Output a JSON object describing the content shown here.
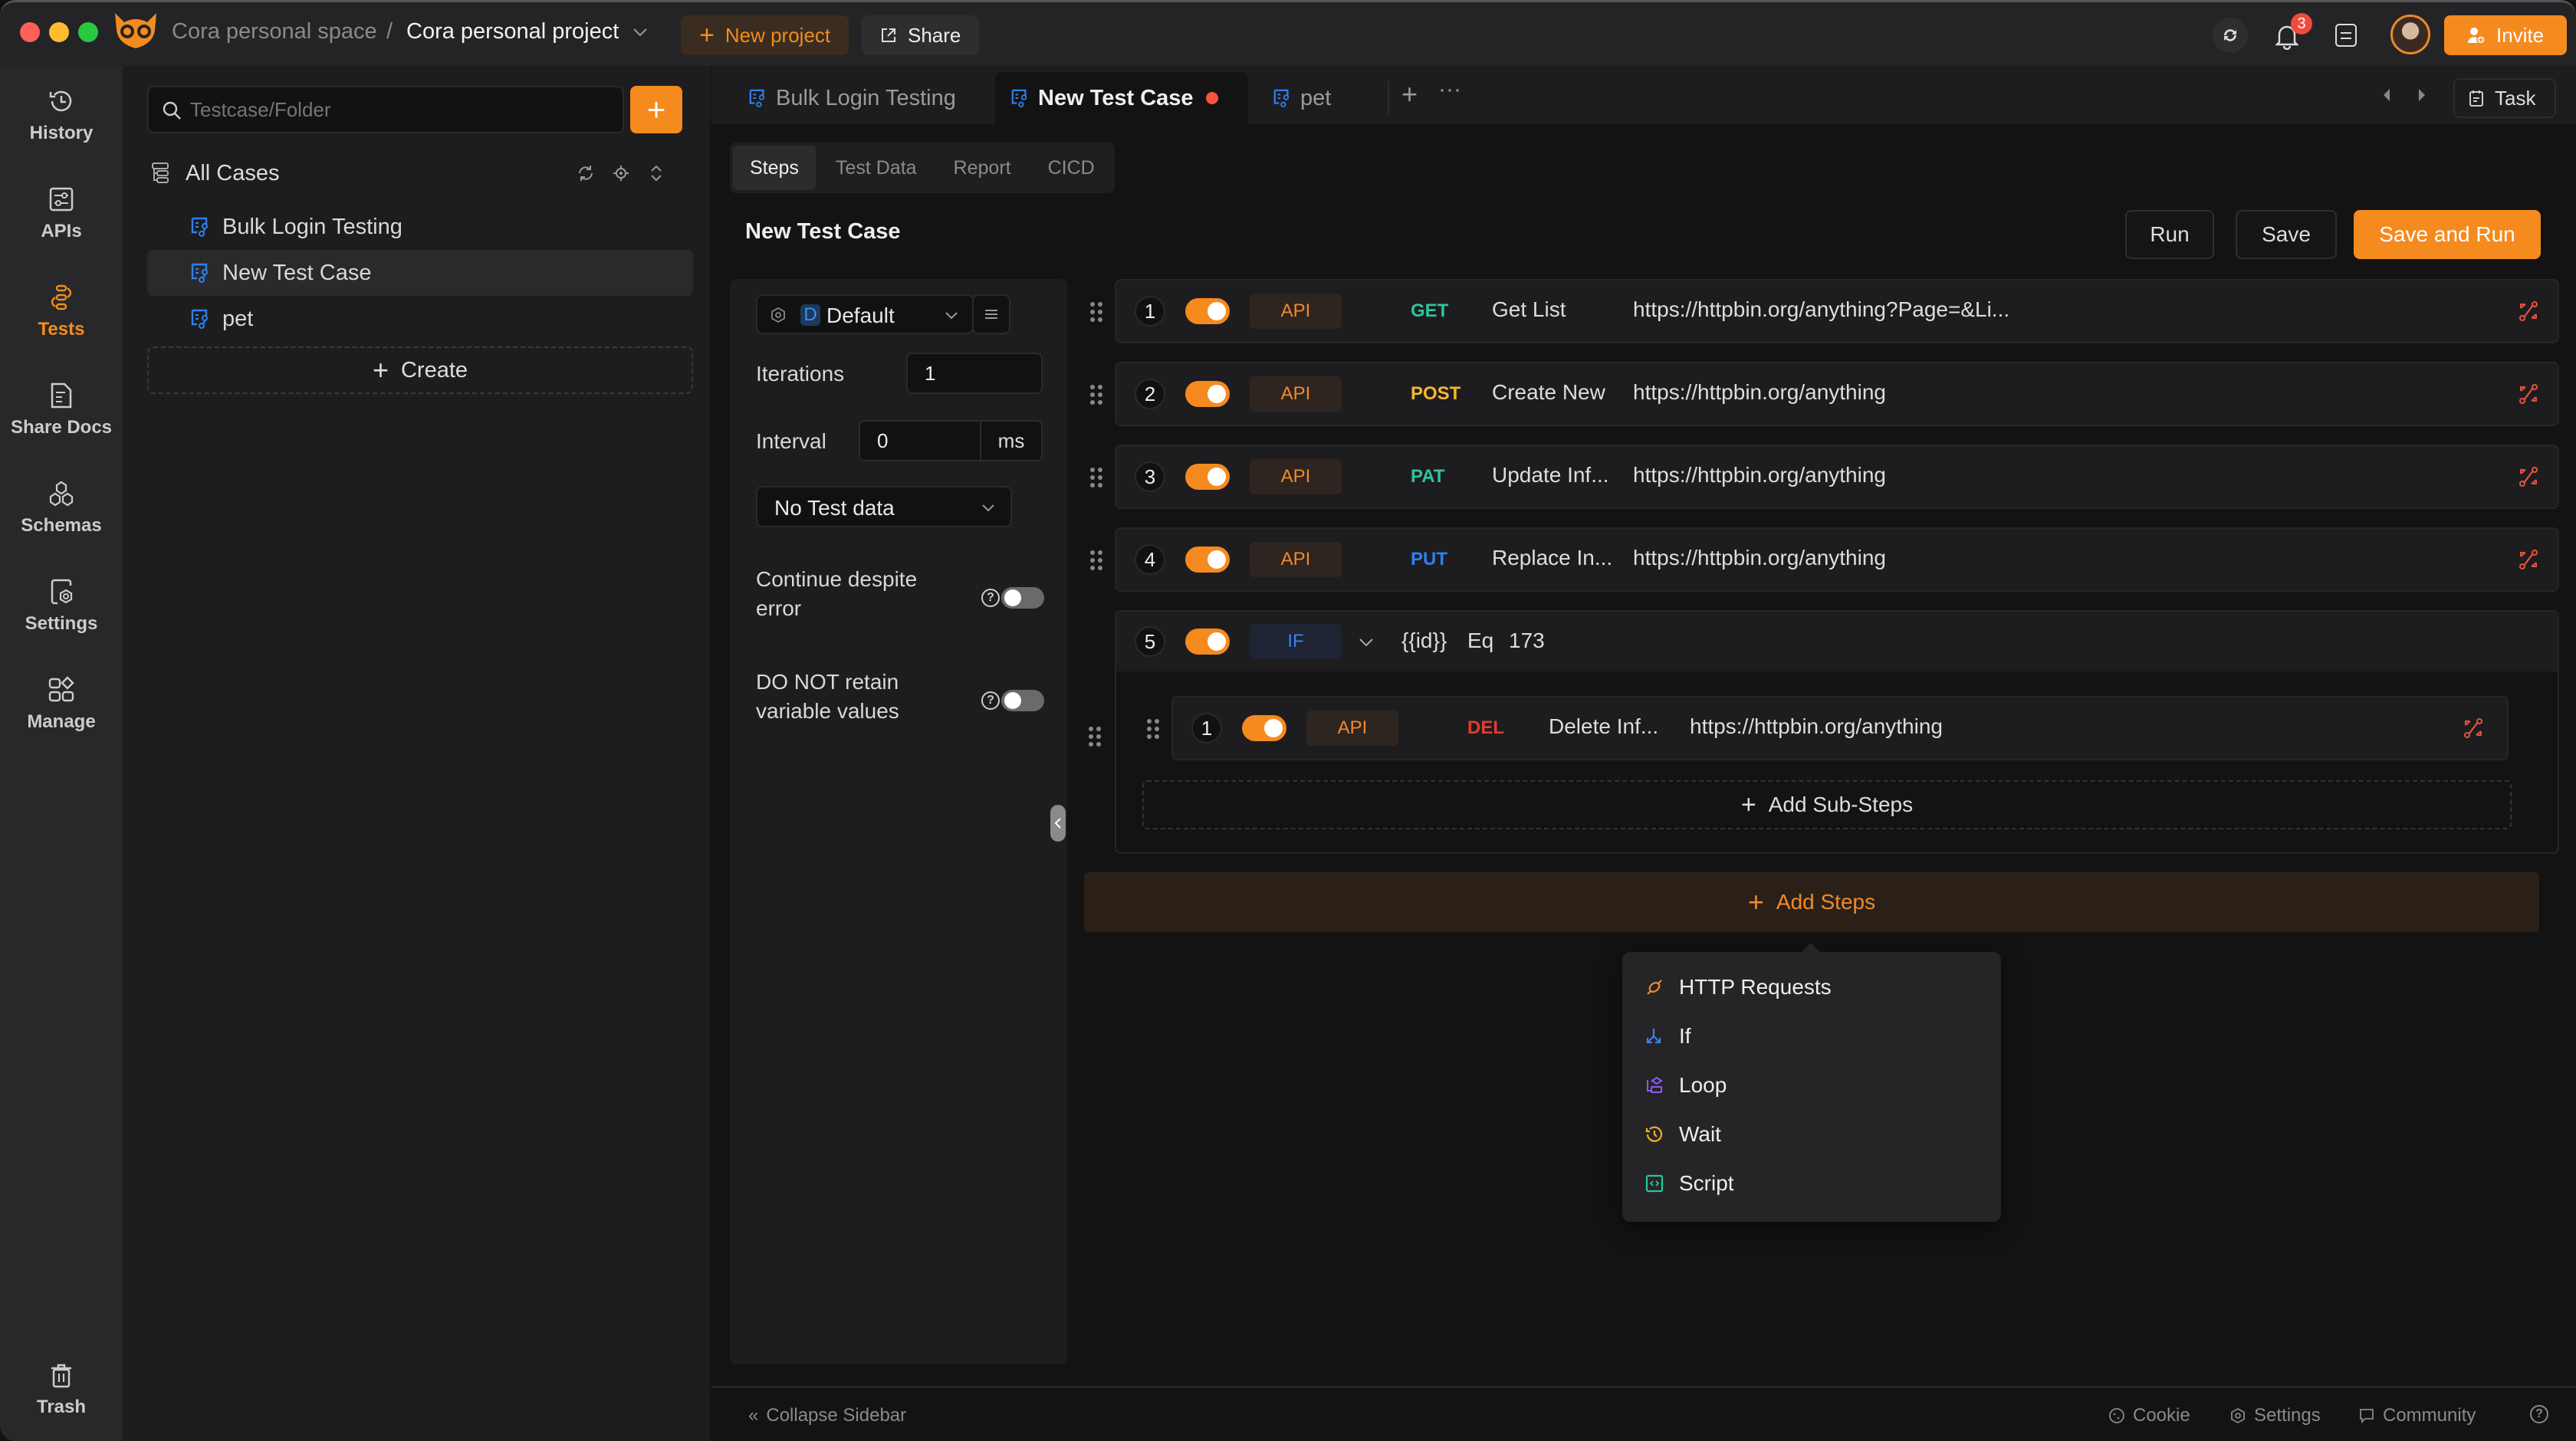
{
  "titlebar": {
    "workspace": "Cora personal space",
    "separator": "/",
    "project": "Cora personal project",
    "new_project_label": "New project",
    "share_label": "Share",
    "notification_count": "3",
    "invite_label": "Invite"
  },
  "rail": {
    "items": [
      {
        "label": "History",
        "icon": "history-icon"
      },
      {
        "label": "APIs",
        "icon": "apis-icon"
      },
      {
        "label": "Tests",
        "icon": "tests-icon",
        "active": true
      },
      {
        "label": "Share Docs",
        "icon": "share-docs-icon"
      },
      {
        "label": "Schemas",
        "icon": "schemas-icon"
      },
      {
        "label": "Settings",
        "icon": "settings-icon"
      },
      {
        "label": "Manage",
        "icon": "manage-icon"
      }
    ],
    "trash_label": "Trash"
  },
  "side": {
    "search_placeholder": "Testcase/Folder",
    "root_label": "All Cases",
    "cases": [
      {
        "label": "Bulk Login Testing"
      },
      {
        "label": "New Test Case",
        "selected": true
      },
      {
        "label": "pet"
      }
    ],
    "create_label": "Create"
  },
  "tabs": {
    "items": [
      {
        "label": "Bulk Login Testing"
      },
      {
        "label": "New Test Case",
        "active": true,
        "unsaved": true
      },
      {
        "label": "pet"
      }
    ],
    "task_label": "Task"
  },
  "subtabs": [
    "Steps",
    "Test Data",
    "Report",
    "CICD"
  ],
  "editor": {
    "title": "New Test Case",
    "run_label": "Run",
    "save_label": "Save",
    "save_run_label": "Save and Run"
  },
  "config": {
    "env_badge": "D",
    "env_name": "Default",
    "iterations_label": "Iterations",
    "iterations_value": "1",
    "interval_label": "Interval",
    "interval_value": "0",
    "interval_unit": "ms",
    "test_data_value": "No Test data",
    "continue_label_1": "Continue despite",
    "continue_label_2": "error",
    "continue_enabled": false,
    "retain_label_1": "DO NOT retain",
    "retain_label_2": "variable values",
    "retain_enabled": false
  },
  "steps": [
    {
      "n": "1",
      "type": "API",
      "method": "GET",
      "method_color": "#2ec4a0",
      "name": "Get List",
      "url": "https://httpbin.org/anything?Page=&Li..."
    },
    {
      "n": "2",
      "type": "API",
      "method": "POST",
      "method_color": "#f5b82e",
      "name": "Create New",
      "url": "https://httpbin.org/anything"
    },
    {
      "n": "3",
      "type": "API",
      "method": "PAT",
      "method_color": "#2ec4a0",
      "name": "Update Inf...",
      "url": "https://httpbin.org/anything"
    },
    {
      "n": "4",
      "type": "API",
      "method": "PUT",
      "method_color": "#2f80ed",
      "name": "Replace In...",
      "url": "https://httpbin.org/anything"
    }
  ],
  "if_step": {
    "n": "5",
    "type": "IF",
    "variable": "{{id}}",
    "operator": "Eq",
    "value": "173",
    "sub_steps": [
      {
        "n": "1",
        "type": "API",
        "method": "DEL",
        "method_color": "#e23b2e",
        "name": "Delete Inf...",
        "url": "https://httpbin.org/anything"
      }
    ],
    "add_sub_label": "Add Sub-Steps"
  },
  "add_steps_label": "Add Steps",
  "add_menu": [
    {
      "label": "HTTP Requests",
      "icon": "http-plug-icon",
      "color": "#f08a2c"
    },
    {
      "label": "If",
      "icon": "branch-icon",
      "color": "#3e7ee8"
    },
    {
      "label": "Loop",
      "icon": "loop-icon",
      "color": "#8b5cf6"
    },
    {
      "label": "Wait",
      "icon": "clock-icon",
      "color": "#f0b429"
    },
    {
      "label": "Script",
      "icon": "code-icon",
      "color": "#2ec4a0"
    }
  ],
  "footer": {
    "collapse_label": "Collapse Sidebar",
    "cookie_label": "Cookie",
    "settings_label": "Settings",
    "community_label": "Community"
  },
  "colors": {
    "accent": "#f58a1f",
    "swap_icon": "#e5533d"
  }
}
